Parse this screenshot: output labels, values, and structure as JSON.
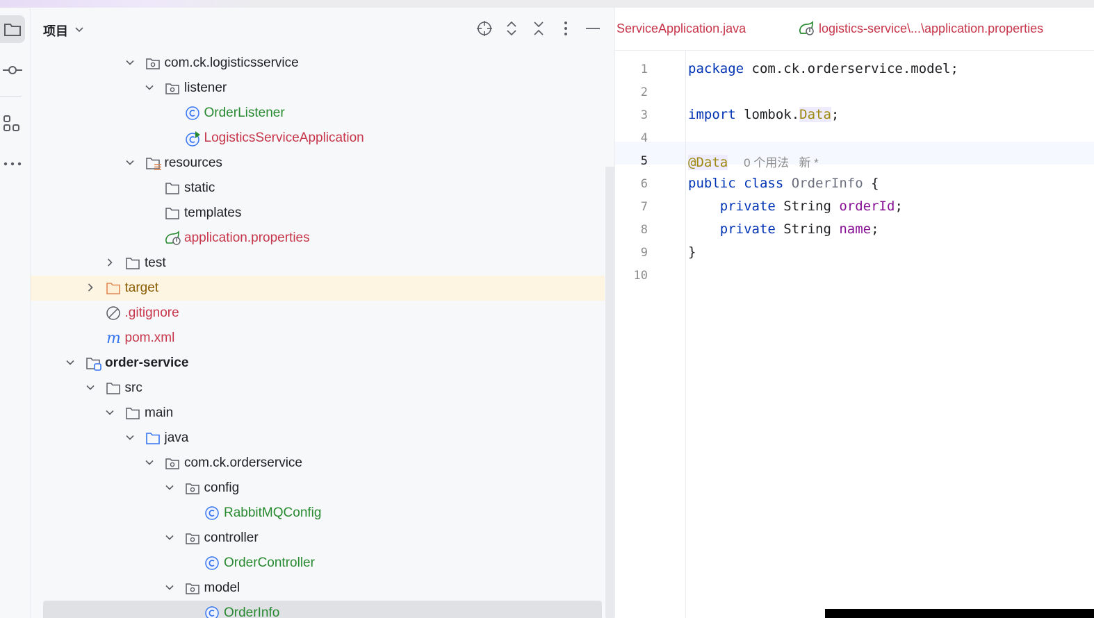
{
  "panel": {
    "title": "项目"
  },
  "tree": [
    {
      "label": "com.ck.logisticsservice",
      "icon": "package-icon",
      "expanded": true,
      "color": "default"
    },
    {
      "label": "listener",
      "icon": "package-icon",
      "expanded": true,
      "color": "default"
    },
    {
      "label": "OrderListener",
      "icon": "class-icon",
      "color": "green"
    },
    {
      "label": "LogisticsServiceApplication",
      "icon": "spring-boot-class-icon",
      "color": "red"
    },
    {
      "label": "resources",
      "icon": "resources-folder-icon",
      "expanded": true,
      "color": "default"
    },
    {
      "label": "static",
      "icon": "folder-icon",
      "color": "default"
    },
    {
      "label": "templates",
      "icon": "folder-icon",
      "color": "default"
    },
    {
      "label": "application.properties",
      "icon": "spring-config-icon",
      "color": "red"
    },
    {
      "label": "test",
      "icon": "folder-icon",
      "expanded": false,
      "color": "default"
    },
    {
      "label": "target",
      "icon": "excluded-folder-icon",
      "expanded": false,
      "color": "orange"
    },
    {
      "label": ".gitignore",
      "icon": "ignored-file-icon",
      "color": "red"
    },
    {
      "label": "pom.xml",
      "icon": "maven-icon",
      "color": "red"
    },
    {
      "label": "order-service",
      "icon": "module-folder-icon",
      "expanded": true,
      "color": "bold"
    },
    {
      "label": "src",
      "icon": "folder-icon",
      "expanded": true,
      "color": "default"
    },
    {
      "label": "main",
      "icon": "folder-icon",
      "expanded": true,
      "color": "default"
    },
    {
      "label": "java",
      "icon": "source-folder-icon",
      "expanded": true,
      "color": "default"
    },
    {
      "label": "com.ck.orderservice",
      "icon": "package-icon",
      "expanded": true,
      "color": "default"
    },
    {
      "label": "config",
      "icon": "package-icon",
      "expanded": true,
      "color": "default"
    },
    {
      "label": "RabbitMQConfig",
      "icon": "class-icon",
      "color": "green"
    },
    {
      "label": "controller",
      "icon": "package-icon",
      "expanded": true,
      "color": "default"
    },
    {
      "label": "OrderController",
      "icon": "class-icon",
      "color": "green"
    },
    {
      "label": "model",
      "icon": "package-icon",
      "expanded": true,
      "color": "default"
    },
    {
      "label": "OrderInfo",
      "icon": "class-icon",
      "color": "green",
      "selected": true
    }
  ],
  "tabs": [
    {
      "label": "ServiceApplication.java"
    },
    {
      "label": "logistics-service\\...\\application.properties",
      "icon": "spring-config-icon"
    }
  ],
  "editor": {
    "current_line": "5",
    "line_numbers": [
      "1",
      "2",
      "3",
      "4",
      "5",
      "6",
      "7",
      "8",
      "9",
      "10"
    ],
    "code": {
      "l1_kw": "package",
      "l1_rest": " com.ck.orderservice.model;",
      "l3_kw": "import",
      "l3_a": " lombok.",
      "l3_b": "Data",
      "l3_c": ";",
      "l5_ann": "@Data",
      "l5_hint": "0 个用法   新 *",
      "l6_kw": "public class",
      "l6_cls": " OrderInfo",
      "l6_rest": " {",
      "l7_ind": "    ",
      "l7_kw": "private",
      "l7_type": " String ",
      "l7_fld": "orderId",
      "l7_end": ";",
      "l8_ind": "    ",
      "l8_kw": "private",
      "l8_type": " String ",
      "l8_fld": "name",
      "l8_end": ";",
      "l9": "}"
    }
  },
  "colors": {
    "accent": "#3574f0",
    "class_green": "#27892f",
    "vcs_red": "#c7354a",
    "keyword": "#0033b3"
  }
}
